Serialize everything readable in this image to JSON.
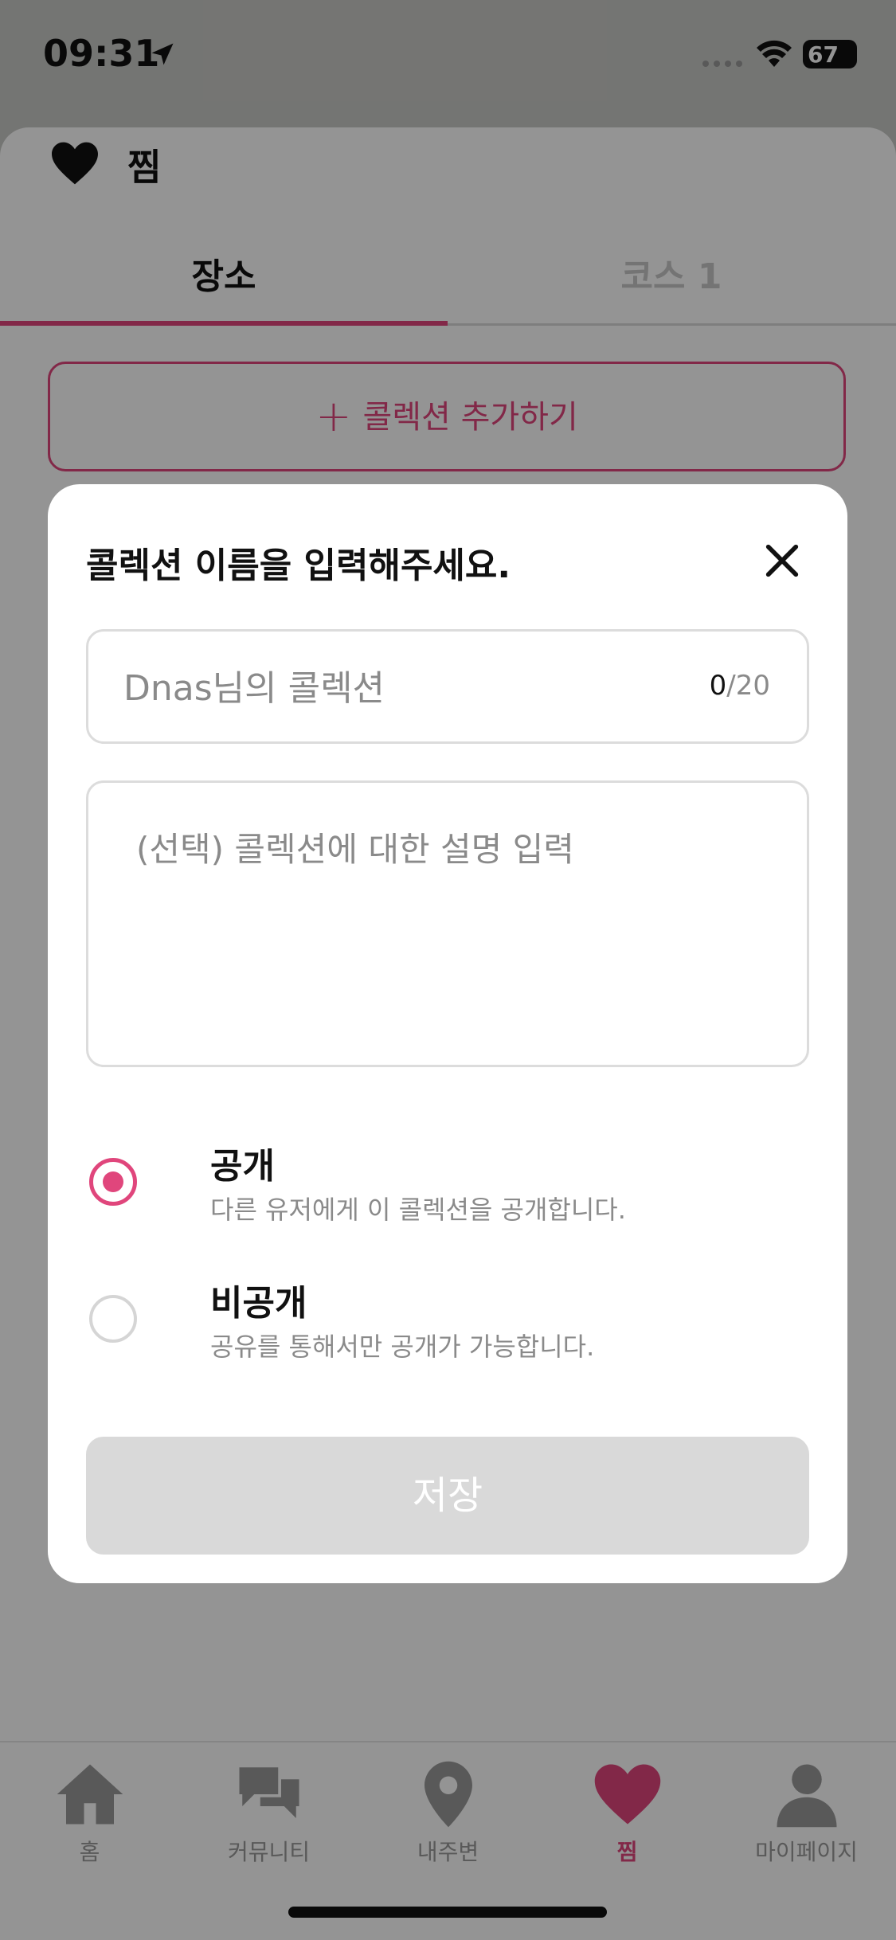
{
  "status_bar": {
    "time": "09:31",
    "battery": "67"
  },
  "header": {
    "title": "찜"
  },
  "tabs": [
    {
      "label": "장소",
      "active": true
    },
    {
      "label": "코스 1",
      "active": false
    }
  ],
  "add_collection": {
    "label": "콜렉션 추가하기"
  },
  "modal": {
    "title": "콜렉션 이름을 입력해주세요.",
    "name_field": {
      "placeholder": "Dnas님의 콜렉션",
      "value": "",
      "count_current": "0",
      "count_max": "/20"
    },
    "description_field": {
      "placeholder": "(선택) 콜렉션에 대한 설명 입력",
      "value": ""
    },
    "options": [
      {
        "title": "공개",
        "description": "다른 유저에게 이 콜렉션을 공개합니다.",
        "selected": true
      },
      {
        "title": "비공개",
        "description": "공유를 통해서만 공개가 가능합니다.",
        "selected": false
      }
    ],
    "save_label": "저장"
  },
  "bottom_nav": [
    {
      "label": "홈",
      "icon": "home-icon",
      "active": false
    },
    {
      "label": "커뮤니티",
      "icon": "chat-bubbles-icon",
      "active": false
    },
    {
      "label": "내주변",
      "icon": "location-pin-icon",
      "active": false
    },
    {
      "label": "찜",
      "icon": "heart-icon",
      "active": true
    },
    {
      "label": "마이페이지",
      "icon": "person-icon",
      "active": false
    }
  ],
  "colors": {
    "accent": "#e0467c",
    "disabled": "#d9d9d9",
    "muted_text": "#8a8a8a"
  }
}
